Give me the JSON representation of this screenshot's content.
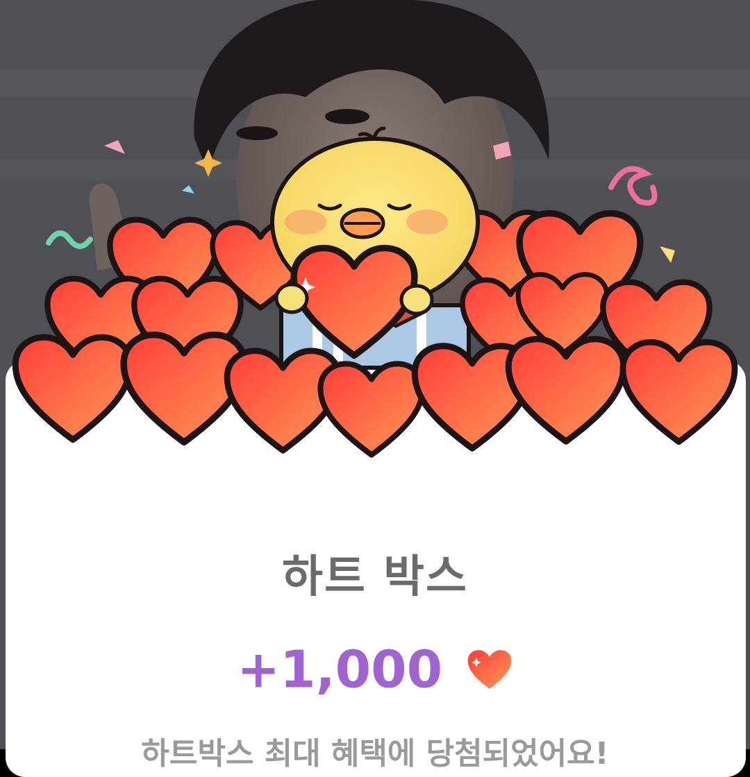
{
  "reward": {
    "title": "하트 박스",
    "amount": "+1,000",
    "amount_icon": "heart-icon",
    "message": "하트박스 최대 혜택에 당첨되었어요!"
  },
  "colors": {
    "card_bg": "#ffffff",
    "title": "#6b6b6b",
    "amount": "#a064d2",
    "heart": "#ff5a3c",
    "message": "#9a9a9a"
  }
}
